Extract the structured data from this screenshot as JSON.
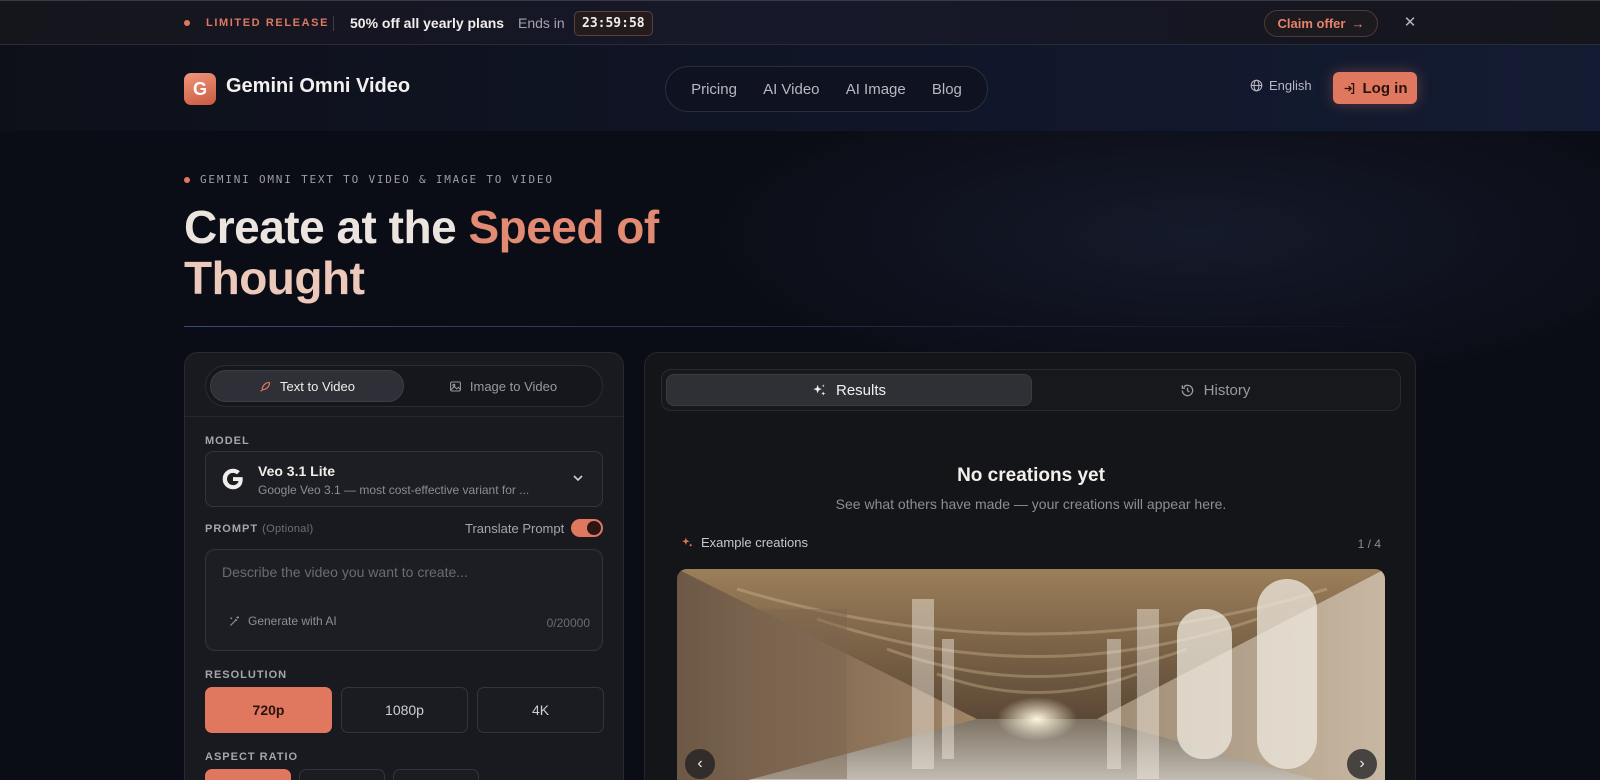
{
  "promo": {
    "tag": "LIMITED RELEASE",
    "offer": "50% off all yearly plans",
    "ends_label": "Ends in",
    "timer": "23:59:58",
    "claim_label": "Claim offer",
    "claim_arrow": "→",
    "close": "✕"
  },
  "header": {
    "logo_letter": "G",
    "brand": "Gemini Omni Video",
    "nav": [
      "Pricing",
      "AI Video",
      "AI Image",
      "Blog"
    ],
    "language": "English",
    "login_label": "Log in"
  },
  "hero": {
    "eyebrow": "GEMINI OMNI TEXT TO VIDEO & IMAGE TO VIDEO",
    "title_part1": "Create at the ",
    "title_part2": "Speed of",
    "title_part3": "Thought"
  },
  "generator": {
    "tabs": {
      "text_to_video": "Text to Video",
      "image_to_video": "Image to Video"
    },
    "model_label": "MODEL",
    "model_name": "Veo 3.1 Lite",
    "model_desc": "Google Veo 3.1 — most cost-effective variant for ...",
    "prompt_label": "PROMPT",
    "prompt_optional": "(Optional)",
    "translate_label": "Translate Prompt",
    "prompt_placeholder": "Describe the video you want to create...",
    "generate_ai": "Generate with AI",
    "counter": "0/20000",
    "resolution_label": "RESOLUTION",
    "resolutions": [
      "720p",
      "1080p",
      "4K"
    ],
    "aspect_label": "ASPECT RATIO"
  },
  "results": {
    "tab_results": "Results",
    "tab_history": "History",
    "empty_title": "No creations yet",
    "empty_sub": "See what others have made — your creations will appear here.",
    "examples_label": "Example creations",
    "pager": "1 / 4",
    "prev": "‹",
    "next": "›"
  },
  "colors": {
    "accent": "#e0785f",
    "background": "#0b0d16",
    "panel": "#191a1f"
  },
  "icons": [
    "globe-icon",
    "login-icon",
    "feather-icon",
    "image-icon",
    "google-g-icon",
    "chevron-down-icon",
    "magic-wand-icon",
    "sparkles-icon",
    "history-icon",
    "chevron-left-icon",
    "chevron-right-icon",
    "close-icon",
    "arrow-right-icon"
  ]
}
